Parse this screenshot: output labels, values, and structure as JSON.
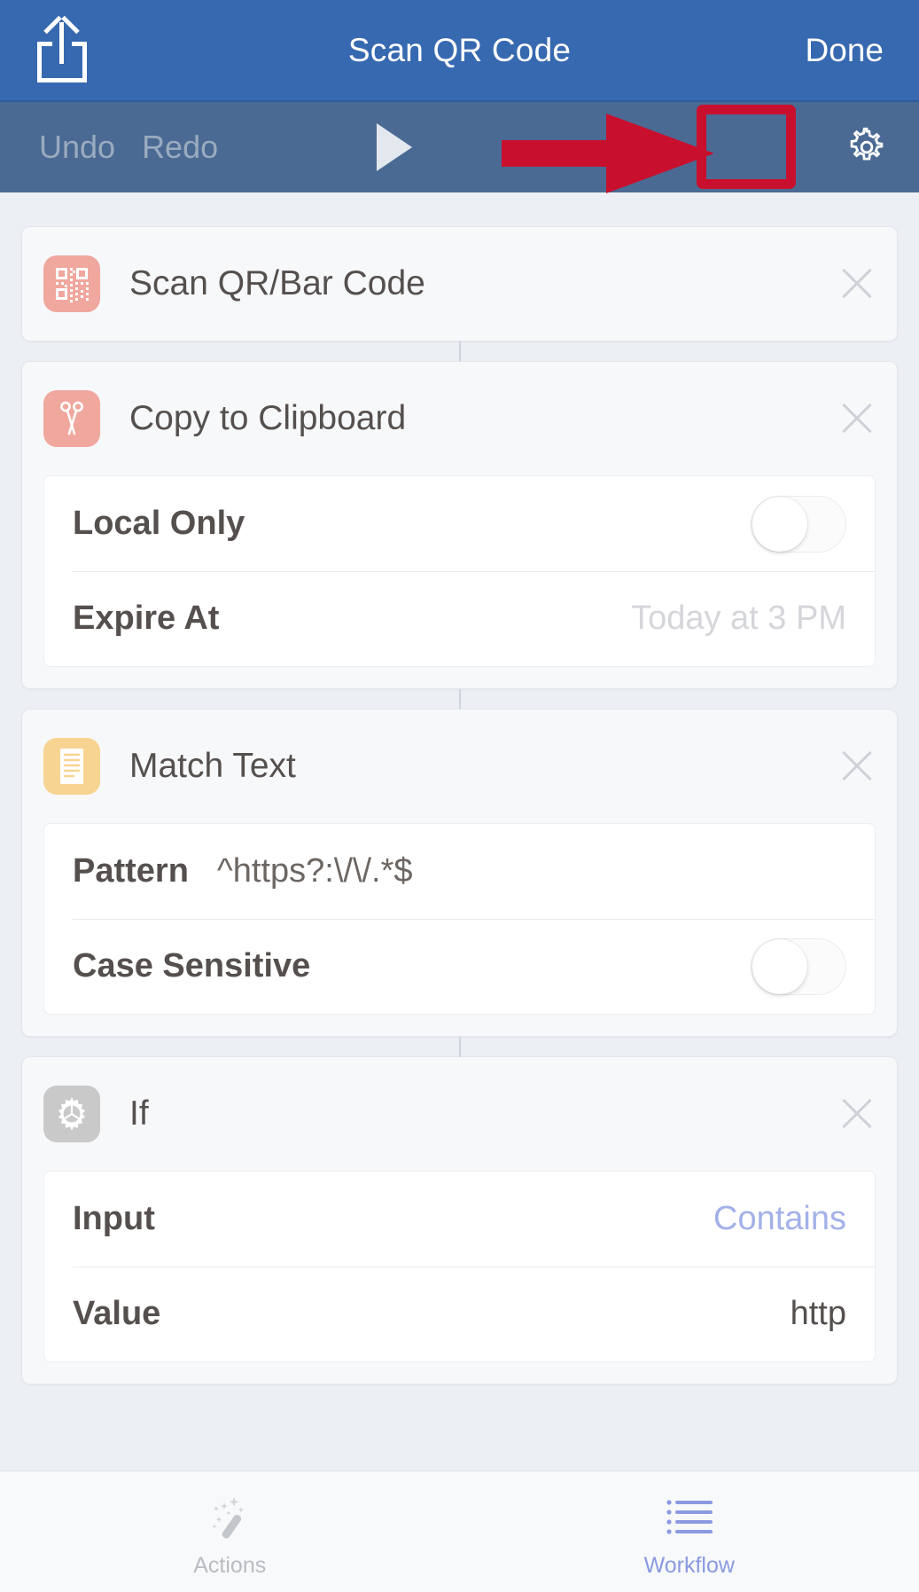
{
  "navbar": {
    "share_icon": "share-export-icon",
    "title": "Scan QR Code",
    "done_label": "Done"
  },
  "toolbar": {
    "undo_label": "Undo",
    "redo_label": "Redo",
    "play_icon": "play-icon",
    "settings_icon": "gear-icon"
  },
  "annotation": {
    "arrow_color": "#c8102e",
    "highlight_color": "#c8102e",
    "target": "settings-gear-button"
  },
  "colors": {
    "navbar_bg": "#3769b0",
    "toolbar_bg": "#4a6a93",
    "page_bg": "#eceff3",
    "card_bg": "#f7f8fa",
    "accent_blue": "#a3b1e8",
    "icon_salmon": "#f0a79d",
    "icon_amber": "#f7d491",
    "icon_gray": "#c9c9c9"
  },
  "actions": [
    {
      "icon": "qr-code-icon",
      "icon_color": "salmon",
      "title": "Scan QR/Bar Code",
      "close_icon": "close-icon",
      "params": []
    },
    {
      "icon": "scissors-icon",
      "icon_color": "salmon",
      "title": "Copy to Clipboard",
      "close_icon": "close-icon",
      "params": [
        {
          "label": "Local Only",
          "type": "toggle",
          "value": "off"
        },
        {
          "label": "Expire At",
          "type": "value",
          "value": "Today at 3 PM"
        }
      ]
    },
    {
      "icon": "document-lines-icon",
      "icon_color": "amber",
      "title": "Match Text",
      "close_icon": "close-icon",
      "params": [
        {
          "label": "Pattern",
          "type": "inline",
          "value": "^https?:\\/\\/.*$"
        },
        {
          "label": "Case Sensitive",
          "type": "toggle",
          "value": "off"
        }
      ]
    },
    {
      "icon": "gear-icon",
      "icon_color": "gray",
      "title": "If",
      "close_icon": "close-icon",
      "params": [
        {
          "label": "Input",
          "type": "accent",
          "value": "Contains"
        },
        {
          "label": "Value",
          "type": "dark",
          "value": "http"
        }
      ]
    }
  ],
  "tabbar": {
    "tabs": [
      {
        "icon": "magic-wand-icon",
        "label": "Actions",
        "active": false
      },
      {
        "icon": "list-icon",
        "label": "Workflow",
        "active": true
      }
    ]
  }
}
